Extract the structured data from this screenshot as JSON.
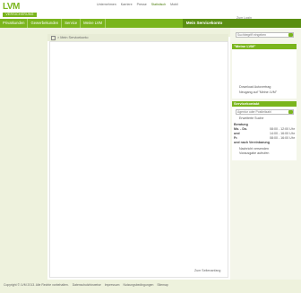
{
  "logo": {
    "mark": "LVM",
    "sub": "VERSICHERUNG"
  },
  "topnav": [
    "Unternehmen",
    "Karriere",
    "Presse",
    "Statistisch",
    "Mobil"
  ],
  "login": "Zum Login",
  "mainnav": [
    "Privatkunden",
    "Gewerbekunden",
    "Service",
    "Meine LVM"
  ],
  "service_tab": "Mein Servicekonto",
  "breadcrumb": "> Mein Servicekonto",
  "top_link": "Zum Seitenanfang",
  "search_placeholder": "Suchbegriff eingeben",
  "meine_lvm": {
    "title": "\"Meine LVM\"",
    "line1": "Download Autovertrag",
    "line2": "Neugang auf \"Meine LVM\""
  },
  "service_box": {
    "title": "Servicekontakt",
    "input_placeholder": "Agentur oder Postleitzahl",
    "link": "Erweiterte Suche",
    "hours_title": "Beratung",
    "hours": [
      {
        "day": "Mo. - Do.",
        "time": "08:00 - 12:00 Uhr"
      },
      {
        "day": "und",
        "time": "14:00 - 16:00 Uhr"
      },
      {
        "day": "Fr.",
        "time": "08:00 - 16:00 Uhr"
      }
    ],
    "after": "und nach Vereinbarung",
    "note1": "Nachricht versenden",
    "note2": "Vorausgabe aufrufen"
  },
  "footer": [
    "Copyright © LVM 2013. Alle Rechte vorbehalten.",
    "Datenschutzhinweise",
    "Impressum",
    "Nutzungsbedingungen",
    "Sitemap"
  ]
}
